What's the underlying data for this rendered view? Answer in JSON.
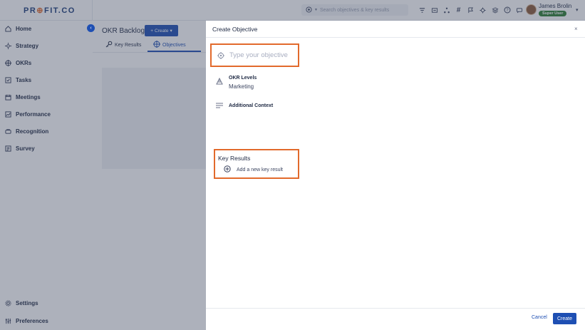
{
  "app": {
    "logo_text_1": "PR",
    "logo_text_2": "FIT.CO"
  },
  "topbar": {
    "search_placeholder": "Search objectives & key results",
    "icons": [
      "filter-icon",
      "cart-icon",
      "network-icon",
      "hash-icon",
      "flag-icon",
      "gear-alt-icon",
      "layers-icon",
      "help-icon",
      "chat-icon"
    ],
    "user_name": "James Brolin",
    "user_role": "Super User"
  },
  "sidebar": {
    "items": [
      {
        "label": "Home",
        "icon": "home-icon"
      },
      {
        "label": "Strategy",
        "icon": "strategy-icon"
      },
      {
        "label": "OKRs",
        "icon": "okr-target-icon"
      },
      {
        "label": "Tasks",
        "icon": "tasks-icon"
      },
      {
        "label": "Meetings",
        "icon": "meetings-icon"
      },
      {
        "label": "Performance",
        "icon": "performance-icon"
      },
      {
        "label": "Recognition",
        "icon": "recognition-icon"
      },
      {
        "label": "Survey",
        "icon": "survey-icon"
      }
    ],
    "bottom": [
      {
        "label": "Settings",
        "icon": "settings-icon"
      },
      {
        "label": "Preferences",
        "icon": "preferences-icon"
      }
    ]
  },
  "main": {
    "title": "OKR Backlog",
    "create_label": "Create",
    "tabs": [
      {
        "label": "Key Results",
        "icon": "key-icon"
      },
      {
        "label": "Objectives",
        "icon": "target-icon",
        "active": true
      }
    ]
  },
  "panel": {
    "title": "Create Objective",
    "objective_placeholder": "Type your objective",
    "okr_levels_label": "OKR Levels",
    "okr_levels_value": "Marketing",
    "additional_context_label": "Additional Context",
    "key_results_title": "Key Results",
    "add_key_result_label": "Add a new key result",
    "cancel_label": "Cancel",
    "create_label": "Create"
  },
  "colors": {
    "brand_blue": "#1e4fb3",
    "highlight_orange": "#e26a2c",
    "success_green": "#2e7d32"
  }
}
